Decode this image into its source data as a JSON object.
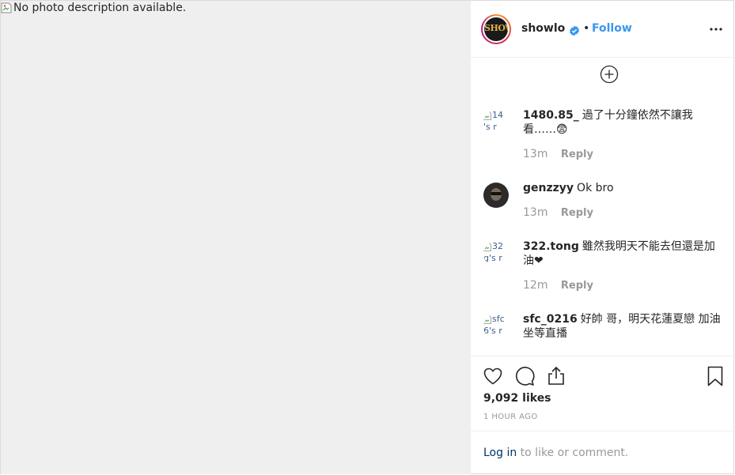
{
  "media": {
    "alt_text": "No photo description available."
  },
  "header": {
    "avatar_text": "SHOW",
    "username": "showlo",
    "separator": "•",
    "follow_label": "Follow"
  },
  "comments": [
    {
      "username": "1480.85_",
      "text": "過了十分鐘依然不讓我看……😨",
      "time": "13m",
      "reply": "Reply",
      "avatar_alt_1": "14",
      "avatar_alt_2": "'s r"
    },
    {
      "username": "genzzyy",
      "text": "Ok bro",
      "time": "13m",
      "reply": "Reply"
    },
    {
      "username": "322.tong",
      "text": "雖然我明天不能去但還是加油❤",
      "time": "12m",
      "reply": "Reply",
      "avatar_alt_1": "32",
      "avatar_alt_2": "g's r"
    },
    {
      "username": "sfc_0216",
      "text": "好帥 哥，明天花蓮夏戀 加油坐等直播",
      "avatar_alt_1": "sfc",
      "avatar_alt_2": "6's r"
    }
  ],
  "stats": {
    "likes": "9,092 likes",
    "posted": "1 HOUR AGO"
  },
  "login": {
    "link": "Log in",
    "rest": " to like or comment."
  },
  "colors": {
    "link_blue": "#3897f0",
    "text": "#262626",
    "muted": "#999999",
    "login_link": "#003569"
  }
}
